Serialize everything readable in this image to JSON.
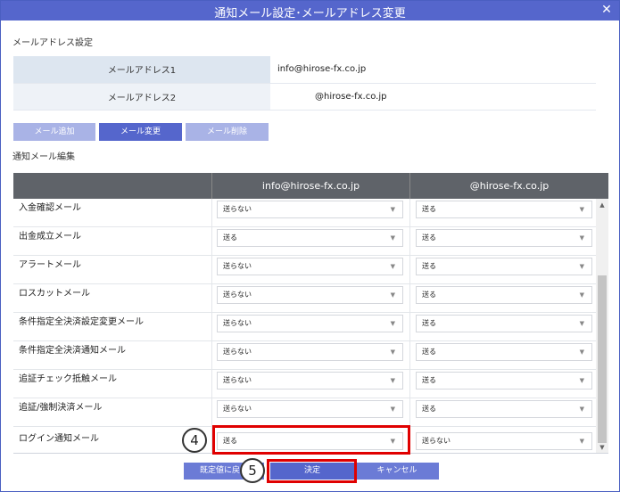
{
  "window": {
    "title": "通知メール設定･メールアドレス変更",
    "close_icon": "close-icon"
  },
  "address_section": {
    "label": "メールアドレス設定",
    "rows": [
      {
        "label": "メールアドレス1",
        "value": "info@hirose-fx.co.jp"
      },
      {
        "label": "メールアドレス2",
        "value": "@hirose-fx.co.jp"
      }
    ]
  },
  "buttons": {
    "add": "メール追加",
    "change": "メール変更",
    "delete": "メール削除"
  },
  "notify_section": {
    "label": "通知メール編集",
    "columns": [
      "",
      "info@hirose-fx.co.jp",
      "@hirose-fx.co.jp"
    ],
    "rows": [
      {
        "label": "入金確認メール",
        "v1": "送らない",
        "v2": "送る"
      },
      {
        "label": "出金成立メール",
        "v1": "送る",
        "v2": "送る"
      },
      {
        "label": "アラートメール",
        "v1": "送らない",
        "v2": "送る"
      },
      {
        "label": "ロスカットメール",
        "v1": "送らない",
        "v2": "送る"
      },
      {
        "label": "条件指定全決済設定変更メール",
        "v1": "送らない",
        "v2": "送る"
      },
      {
        "label": "条件指定全決済通知メール",
        "v1": "送らない",
        "v2": "送る"
      },
      {
        "label": "追証チェック抵触メール",
        "v1": "送らない",
        "v2": "送る"
      },
      {
        "label": "追証/強制決済メール",
        "v1": "送らない",
        "v2": "送る"
      },
      {
        "label": "ログイン通知メール",
        "v1": "送る",
        "v2": "送らない"
      }
    ]
  },
  "annotations": {
    "step4": "4",
    "step5": "5"
  },
  "footer": {
    "default": "既定値に戻す",
    "ok": "決定",
    "cancel": "キャンセル"
  },
  "colors": {
    "accent": "#5566cc",
    "highlight": "#e00000",
    "header_dark": "#5f6369"
  }
}
